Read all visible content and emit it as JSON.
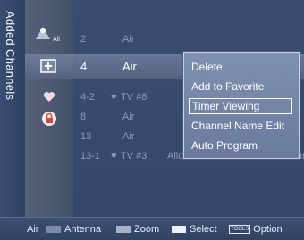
{
  "sidebar": {
    "title": "Added Channels",
    "all_label": "All"
  },
  "channels": [
    {
      "number": "2",
      "name": "Air",
      "prefix": "",
      "extra": ""
    },
    {
      "number": "4",
      "name": "Air",
      "prefix": "",
      "extra": ""
    },
    {
      "number": "4-2",
      "name": "TV #8",
      "prefix": "♥",
      "extra": ""
    },
    {
      "number": "8",
      "name": "Air",
      "prefix": "",
      "extra": ""
    },
    {
      "number": "13",
      "name": "Air",
      "prefix": "",
      "extra": ""
    },
    {
      "number": "13-1",
      "name": "TV #3",
      "prefix": "♥",
      "extra": "Alice's Adventures in Wonderland"
    }
  ],
  "context_menu": {
    "items": [
      "Delete",
      "Add to Favorite",
      "Timer Viewing",
      "Channel Name Edit",
      "Auto Program"
    ],
    "focused_index": 2
  },
  "bottom_bar": {
    "air_label": "Air",
    "antenna_label": "Antenna",
    "zoom_label": "Zoom",
    "select_label": "Select",
    "tools_key": "TOOLS",
    "option_label": "Option"
  },
  "colors": {
    "accent": "#6a7898",
    "menu_focus_border": "#ffffff"
  },
  "icons": [
    "all-channels-icon",
    "added-channel-icon",
    "favorite-heart-icon",
    "locked-channel-icon"
  ]
}
